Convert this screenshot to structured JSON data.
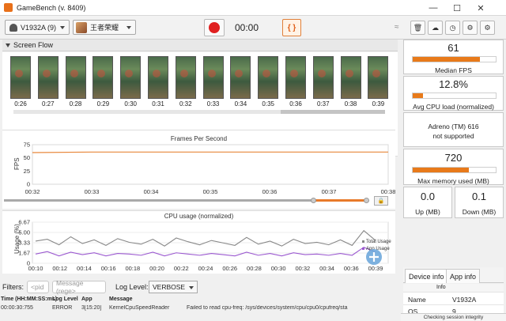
{
  "window": {
    "title": "GameBench (v. 8409)"
  },
  "toolbar": {
    "device": "V1932A (9)",
    "app": "王者荣耀",
    "timer": "00:00",
    "json_label": "{ }"
  },
  "screen_flow": {
    "label": "Screen Flow",
    "times": [
      "0:26",
      "0:27",
      "0:28",
      "0:29",
      "0:30",
      "0:31",
      "0:32",
      "0:33",
      "0:34",
      "0:35",
      "0:36",
      "0:37",
      "0:38",
      "0:39"
    ]
  },
  "fps_chart": {
    "title": "Frames Per Second",
    "ylabel": "FPS",
    "yticks": [
      "75",
      "50",
      "25",
      "0"
    ],
    "xticks": [
      "00:32",
      "00:33",
      "00:34",
      "00:35",
      "00:36",
      "00:37",
      "00:38"
    ]
  },
  "cpu_chart": {
    "title": "CPU usage (normalized)",
    "ylabel": "Usage (%)",
    "yticks": [
      "6.67",
      "5.00",
      "3.33",
      "1.67",
      "0"
    ],
    "xticks": [
      "00:10",
      "00:12",
      "00:14",
      "00:16",
      "00:18",
      "00:20",
      "00:22",
      "00:24",
      "00:26",
      "00:28",
      "00:30",
      "00:32",
      "00:34",
      "00:36",
      "00:39"
    ],
    "legend_total": "Total Usage",
    "legend_app": "App Usage"
  },
  "chart_data": [
    {
      "type": "line",
      "title": "Frames Per Second",
      "ylabel": "FPS",
      "x": [
        "00:32",
        "00:33",
        "00:34",
        "00:35",
        "00:36",
        "00:37",
        "00:38"
      ],
      "series": [
        {
          "values": [
            60,
            61,
            61,
            61,
            61,
            61,
            61
          ]
        }
      ],
      "ylim": [
        0,
        75
      ],
      "color": "#e8873a"
    },
    {
      "type": "line",
      "title": "CPU usage (normalized)",
      "ylabel": "Usage (%)",
      "ylim": [
        0,
        6.67
      ],
      "x": [
        "00:10",
        "00:11",
        "00:12",
        "00:13",
        "00:14",
        "00:15",
        "00:16",
        "00:17",
        "00:18",
        "00:19",
        "00:20",
        "00:21",
        "00:22",
        "00:23",
        "00:24",
        "00:25",
        "00:26",
        "00:27",
        "00:28",
        "00:29",
        "00:30",
        "00:31",
        "00:32",
        "00:33",
        "00:34",
        "00:35",
        "00:36",
        "00:37",
        "00:38",
        "00:39"
      ],
      "series": [
        {
          "name": "Total Usage",
          "color": "#888888",
          "values": [
            3.6,
            3.9,
            3.0,
            4.3,
            3.2,
            3.8,
            2.9,
            4.0,
            3.4,
            3.1,
            3.9,
            2.8,
            4.1,
            3.5,
            3.0,
            3.7,
            3.3,
            2.9,
            4.2,
            3.1,
            3.6,
            2.8,
            3.9,
            3.2,
            3.4,
            3.0,
            3.8,
            2.9,
            5.3,
            3.7
          ]
        },
        {
          "name": "App Usage",
          "color": "#9b59d0",
          "values": [
            1.5,
            1.9,
            1.2,
            1.8,
            1.4,
            1.7,
            1.2,
            1.6,
            1.5,
            1.3,
            1.8,
            1.2,
            1.7,
            1.5,
            1.3,
            1.6,
            1.4,
            1.2,
            1.8,
            1.3,
            1.6,
            1.2,
            1.7,
            1.4,
            1.5,
            1.3,
            1.6,
            1.3,
            2.6,
            1.8
          ]
        }
      ]
    }
  ],
  "filters": {
    "label": "Filters:",
    "pid_placeholder": "<pid",
    "message_placeholder": "Message (rege>",
    "loglevel_label": "Log Level:",
    "loglevel_value": "VERBOSE"
  },
  "log": {
    "headers": [
      "Time (HH:MM:SS:ms)",
      "Log Level",
      "App",
      "Message"
    ],
    "row": [
      "00:00:30:755",
      "ERROR",
      "3[15:20]",
      "KernelCpuSpeedReader",
      "Failed to read cpu-freq: /sys/devices/system/cpu/cpu0/cpufreq/sta"
    ]
  },
  "stats": {
    "fps_value": "61",
    "fps_label": "Median FPS",
    "fps_fill": 0.81,
    "cpu_value": "12.8%",
    "cpu_label": "Avg CPU load (normalized)",
    "cpu_fill": 0.128,
    "gpu_line1": "Adreno (TM) 616",
    "gpu_line2": "not supported",
    "mem_value": "720",
    "mem_label": "Max memory used (MB)",
    "mem_fill": 0.68,
    "up_value": "0.0",
    "up_label": "Up (MB)",
    "down_value": "0.1",
    "down_label": "Down (MB)"
  },
  "device_info": {
    "tab_device": "Device info",
    "tab_app": "App info",
    "col_info": "Info",
    "rows": [
      {
        "k": "Name",
        "v": "V1932A"
      },
      {
        "k": "OS",
        "v": "9"
      }
    ]
  },
  "status": {
    "text": "Checking session integrity"
  },
  "colors": {
    "accent": "#e87a1a",
    "record": "#e02020",
    "app_usage": "#9b59d0",
    "total_usage": "#888888"
  }
}
